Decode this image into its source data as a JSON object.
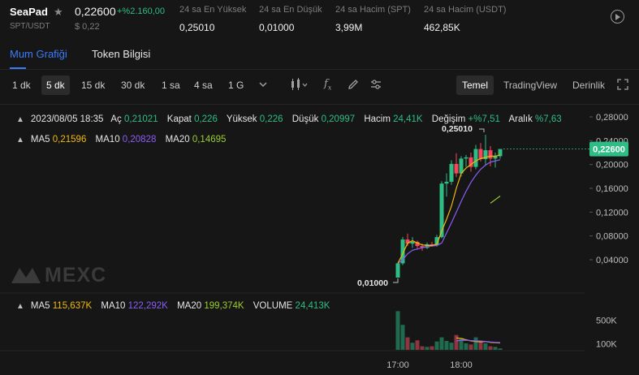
{
  "header": {
    "symbol": "SeaPad",
    "pair": "SPT/USDT",
    "price": "0,22600",
    "change": "+%2.160,00",
    "usd_price": "$ 0,22",
    "stats": [
      {
        "label": "24 sa En Yüksek",
        "value": "0,25010"
      },
      {
        "label": "24 sa En Düşük",
        "value": "0,01000"
      },
      {
        "label": "24 sa Hacim (SPT)",
        "value": "3,99M"
      },
      {
        "label": "24 sa Hacim (USDT)",
        "value": "462,85K"
      }
    ]
  },
  "tabs": [
    {
      "label": "Mum Grafiği",
      "active": true
    },
    {
      "label": "Token Bilgisi",
      "active": false
    }
  ],
  "toolbar": {
    "intervals": [
      "1 dk",
      "5 dk",
      "15 dk",
      "30 dk",
      "1 sa",
      "4 sa",
      "1 G"
    ],
    "active_interval": "5 dk",
    "views": [
      "Temel",
      "TradingView",
      "Derinlik"
    ],
    "active_view": "Temel",
    "icons": [
      "chevron-down-icon",
      "candlestick-type-icon",
      "indicator-fx-icon",
      "draw-pen-icon",
      "settings-sliders-icon",
      "fullscreen-icon"
    ]
  },
  "ohlc": {
    "date": "2023/08/05 18:35",
    "open_label": "Aç",
    "open": "0,21021",
    "close_label": "Kapat",
    "close": "0,226",
    "high_label": "Yüksek",
    "high": "0,226",
    "low_label": "Düşük",
    "low": "0,20997",
    "vol_label": "Hacim",
    "vol": "24,41K",
    "change_label": "Değişim",
    "change": "+%7,51",
    "range_label": "Aralık",
    "range": "%7,63"
  },
  "ma": {
    "ma5_label": "MA5",
    "ma5": "0,21596",
    "ma10_label": "MA10",
    "ma10": "0,20828",
    "ma20_label": "MA20",
    "ma20": "0,14695"
  },
  "vol_ma": {
    "ma5_label": "MA5",
    "ma5": "115,637K",
    "ma10_label": "MA10",
    "ma10": "122,292K",
    "ma20_label": "MA20",
    "ma20": "199,374K",
    "volume_label": "VOLUME",
    "volume": "24,413K"
  },
  "watermark": "MEXC",
  "colors": {
    "up": "#2ebd85",
    "down": "#f6465d",
    "ma5": "#f0b90b",
    "ma10": "#8b5cf6",
    "ma20": "#9acd32",
    "accent": "#3d7bfa"
  },
  "chart_data": {
    "type": "candlestick",
    "interval": "5 dk",
    "price_axis": {
      "ticks": [
        "0,28000",
        "0,24000",
        "0,20000",
        "0,16000",
        "0,12000",
        "0,08000",
        "0,04000"
      ],
      "range": [
        0,
        0.29
      ]
    },
    "volume_axis": {
      "ticks": [
        "500K",
        "100K"
      ],
      "range": [
        0,
        700
      ]
    },
    "time_ticks": [
      "17:00",
      "18:00"
    ],
    "last_price_label": "0,22600",
    "high_marker": "0,25010",
    "low_marker": "0,01000",
    "candles": [
      {
        "o": 0.01,
        "h": 0.034,
        "l": 0.01,
        "c": 0.034
      },
      {
        "o": 0.034,
        "h": 0.078,
        "l": 0.031,
        "c": 0.074
      },
      {
        "o": 0.074,
        "h": 0.084,
        "l": 0.063,
        "c": 0.067
      },
      {
        "o": 0.067,
        "h": 0.078,
        "l": 0.06,
        "c": 0.07
      },
      {
        "o": 0.07,
        "h": 0.072,
        "l": 0.057,
        "c": 0.063
      },
      {
        "o": 0.063,
        "h": 0.067,
        "l": 0.055,
        "c": 0.06
      },
      {
        "o": 0.06,
        "h": 0.069,
        "l": 0.058,
        "c": 0.066
      },
      {
        "o": 0.066,
        "h": 0.07,
        "l": 0.062,
        "c": 0.064
      },
      {
        "o": 0.064,
        "h": 0.082,
        "l": 0.062,
        "c": 0.078
      },
      {
        "o": 0.078,
        "h": 0.172,
        "l": 0.076,
        "c": 0.168
      },
      {
        "o": 0.168,
        "h": 0.185,
        "l": 0.146,
        "c": 0.171
      },
      {
        "o": 0.171,
        "h": 0.207,
        "l": 0.166,
        "c": 0.201
      },
      {
        "o": 0.201,
        "h": 0.219,
        "l": 0.179,
        "c": 0.185
      },
      {
        "o": 0.185,
        "h": 0.214,
        "l": 0.18,
        "c": 0.21
      },
      {
        "o": 0.21,
        "h": 0.216,
        "l": 0.196,
        "c": 0.212
      },
      {
        "o": 0.212,
        "h": 0.22,
        "l": 0.188,
        "c": 0.196
      },
      {
        "o": 0.196,
        "h": 0.233,
        "l": 0.192,
        "c": 0.226
      },
      {
        "o": 0.226,
        "h": 0.236,
        "l": 0.205,
        "c": 0.209
      },
      {
        "o": 0.209,
        "h": 0.25,
        "l": 0.199,
        "c": 0.224
      },
      {
        "o": 0.224,
        "h": 0.231,
        "l": 0.197,
        "c": 0.21
      },
      {
        "o": 0.21,
        "h": 0.22,
        "l": 0.195,
        "c": 0.214
      },
      {
        "o": 0.214,
        "h": 0.226,
        "l": 0.21,
        "c": 0.226
      }
    ],
    "volumes": [
      650,
      420,
      210,
      120,
      160,
      60,
      50,
      60,
      140,
      210,
      150,
      120,
      250,
      200,
      110,
      90,
      210,
      150,
      110,
      60,
      50,
      24
    ],
    "ma5_line": [
      0.034,
      0.05,
      0.068,
      0.072,
      0.068,
      0.065,
      0.064,
      0.064,
      0.066,
      0.088,
      0.108,
      0.13,
      0.16,
      0.185,
      0.194,
      0.2,
      0.206,
      0.21,
      0.212,
      0.214,
      0.214,
      0.216
    ],
    "ma10_line": [
      0.034,
      0.04,
      0.05,
      0.056,
      0.058,
      0.06,
      0.062,
      0.063,
      0.064,
      0.068,
      0.085,
      0.102,
      0.12,
      0.138,
      0.155,
      0.17,
      0.182,
      0.192,
      0.199,
      0.204,
      0.206,
      0.208
    ],
    "ma20_line": [
      null,
      null,
      null,
      null,
      null,
      null,
      null,
      null,
      null,
      null,
      null,
      null,
      null,
      null,
      null,
      null,
      null,
      null,
      null,
      0.135,
      0.141,
      0.147
    ],
    "vol_ma5_line": [
      null,
      null,
      null,
      null,
      null,
      null,
      null,
      null,
      null,
      null,
      null,
      null,
      200,
      190,
      170,
      150,
      140,
      135,
      140,
      125,
      120,
      116
    ],
    "vol_ma10_line": [
      null,
      null,
      null,
      null,
      null,
      null,
      null,
      null,
      null,
      null,
      null,
      null,
      150,
      160,
      160,
      155,
      150,
      148,
      140,
      132,
      126,
      122
    ]
  }
}
